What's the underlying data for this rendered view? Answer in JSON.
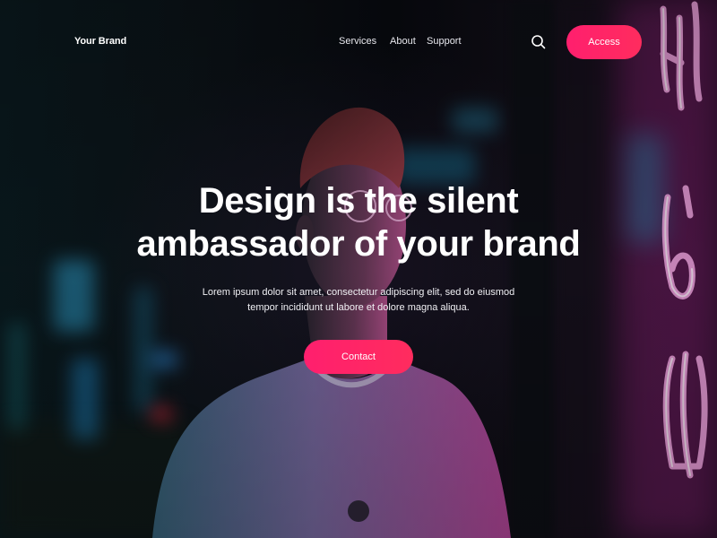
{
  "navbar": {
    "brand": "Your Brand",
    "links": [
      {
        "label": "Services"
      },
      {
        "label": "About"
      },
      {
        "label": "Support"
      }
    ],
    "search_icon": "search-icon",
    "access_label": "Access"
  },
  "hero": {
    "title_line1": "Design is the silent",
    "title_line2": "ambassador of your brand",
    "description_line1": "Lorem ipsum dolor sit amet, consectetur adipiscing elit, sed do eiusmod",
    "description_line2": "tempor incididunt ut labore et dolore magna aliqua.",
    "contact_label": "Contact"
  },
  "colors": {
    "accent": "#ff2366",
    "text": "#ffffff"
  }
}
